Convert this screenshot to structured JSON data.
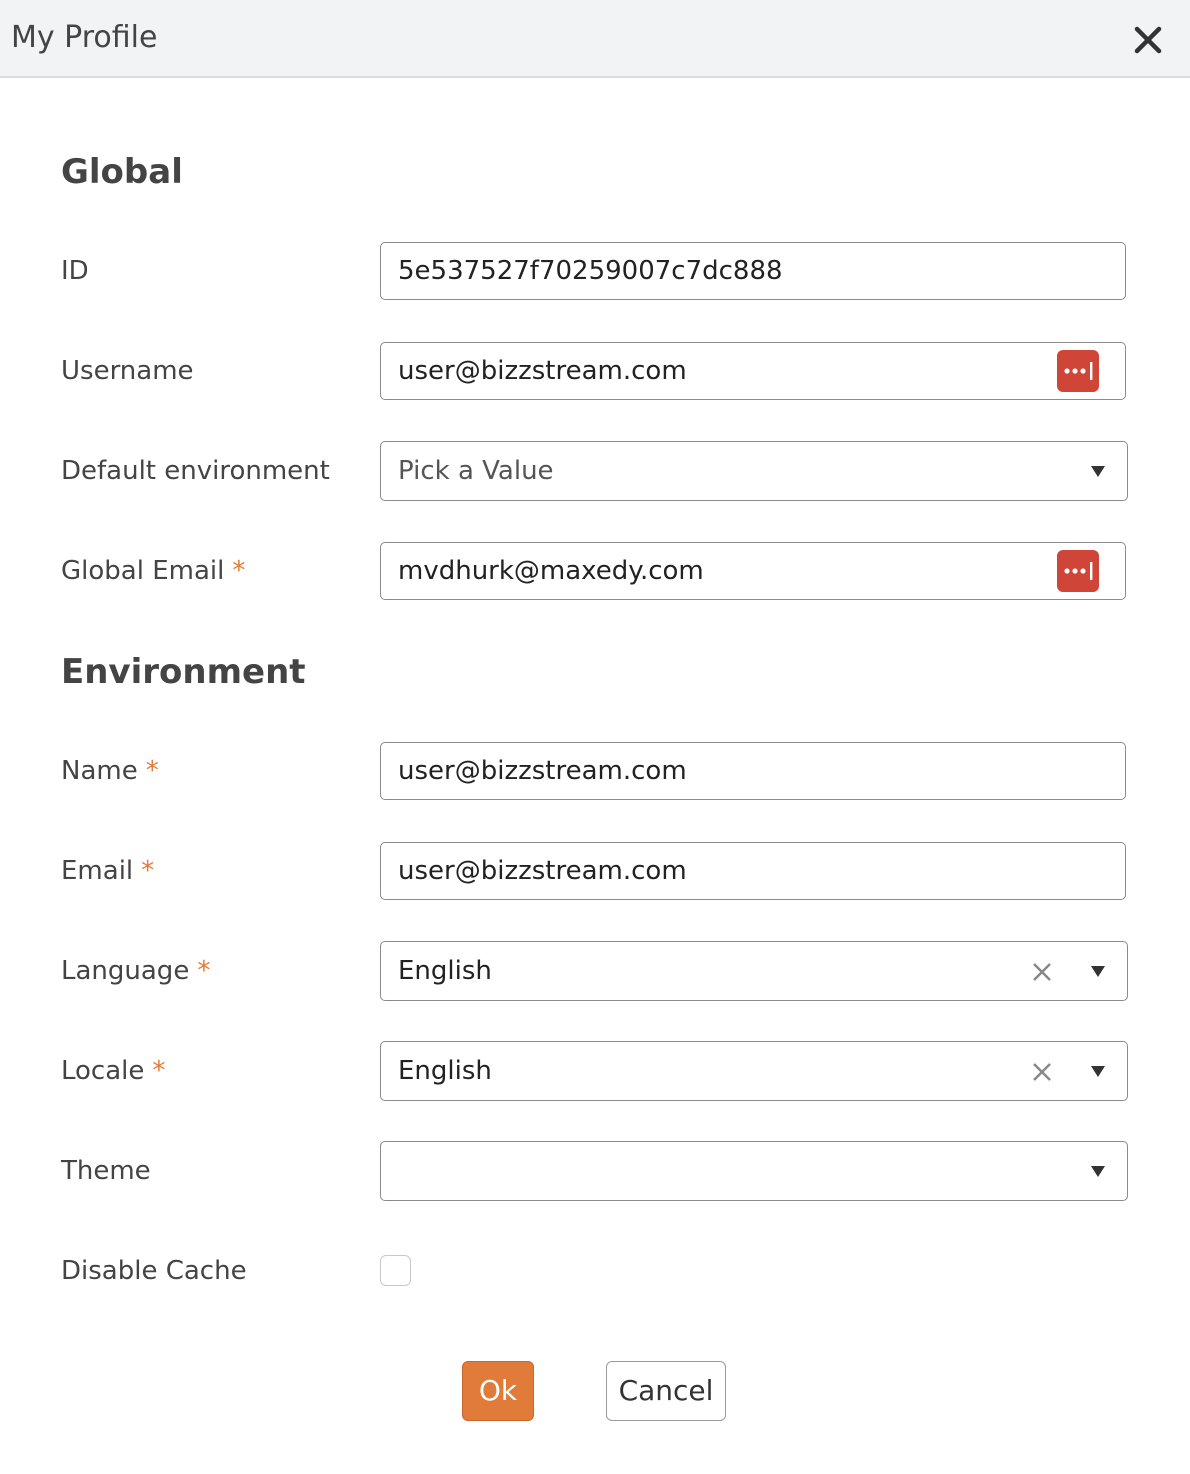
{
  "dialog": {
    "title": "My Profile"
  },
  "sections": {
    "global": "Global",
    "environment": "Environment"
  },
  "fields": {
    "id": {
      "label": "ID",
      "value": "5e537527f70259007c7dc888"
    },
    "username": {
      "label": "Username",
      "value": "user@bizzstream.com"
    },
    "default_environment": {
      "label": "Default environment",
      "placeholder": "Pick a Value"
    },
    "global_email": {
      "label": "Global Email",
      "value": "mvdhurk@maxedy.com"
    },
    "name": {
      "label": "Name",
      "value": "user@bizzstream.com"
    },
    "email": {
      "label": "Email",
      "value": "user@bizzstream.com"
    },
    "language": {
      "label": "Language",
      "value": "English"
    },
    "locale": {
      "label": "Locale",
      "value": "English"
    },
    "theme": {
      "label": "Theme",
      "value": ""
    },
    "disable_cache": {
      "label": "Disable Cache",
      "checked": false
    }
  },
  "required_marker": "*",
  "buttons": {
    "ok": "Ok",
    "cancel": "Cancel"
  },
  "icons": {
    "close": "close-icon",
    "password_manager": "password-manager-icon",
    "clear": "clear-icon",
    "dropdown": "caret-down-icon"
  },
  "colors": {
    "accent": "#e07b39",
    "password_manager": "#cf4638",
    "header_bg": "#f2f3f4"
  }
}
